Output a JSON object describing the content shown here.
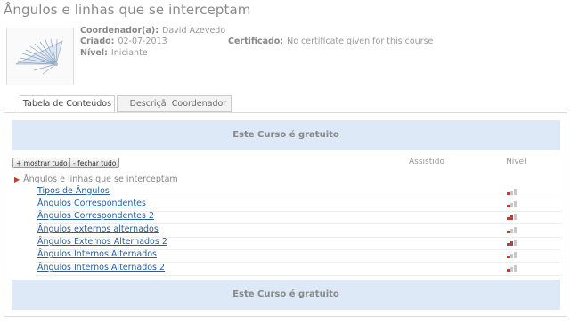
{
  "page_title": "Ângulos e linhas que se interceptam",
  "course_info": {
    "coordinator_label": "Coordenador(a):",
    "coordinator_value": "David Azevedo",
    "created_label": "Criado:",
    "created_value": "02-07-2013",
    "level_label": "Nível:",
    "level_value": "Iniciante",
    "certificate_label": "Certificado:",
    "certificate_value": "No certificate given for this course"
  },
  "tabs": [
    {
      "label": "Tabela de Conteúdos",
      "active": true
    },
    {
      "label": "Descrição",
      "active": false
    },
    {
      "label": "Coordenador",
      "active": false
    }
  ],
  "banner_top": "Este Curso é gratuito",
  "banner_bottom": "Este Curso é gratuito",
  "toolbar": {
    "expand_label": "+ mostrar tudo",
    "collapse_label": "- fechar tudo"
  },
  "columns": {
    "watched": "Assistido",
    "level": "Nível"
  },
  "section_title": "Ângulos e linhas que se interceptam",
  "lessons": [
    {
      "title": "Tipos de Ângulos",
      "level": 1
    },
    {
      "title": "Ângulos Correspondentes",
      "level": 1
    },
    {
      "title": "Ângulos Correspondentes 2",
      "level": 2
    },
    {
      "title": "Ângulos externos alternados",
      "level": 1
    },
    {
      "title": "Ângulos Externos Alternados 2",
      "level": 2
    },
    {
      "title": "Ângulos Internos Alternados",
      "level": 1
    },
    {
      "title": "Ângulos Internos Alternados 2",
      "level": 1
    }
  ],
  "colors": {
    "level_active": "#d9302a",
    "level_inactive": "#c8c8c8",
    "link": "#2a5e9a",
    "banner_bg": "#dde9f7"
  }
}
